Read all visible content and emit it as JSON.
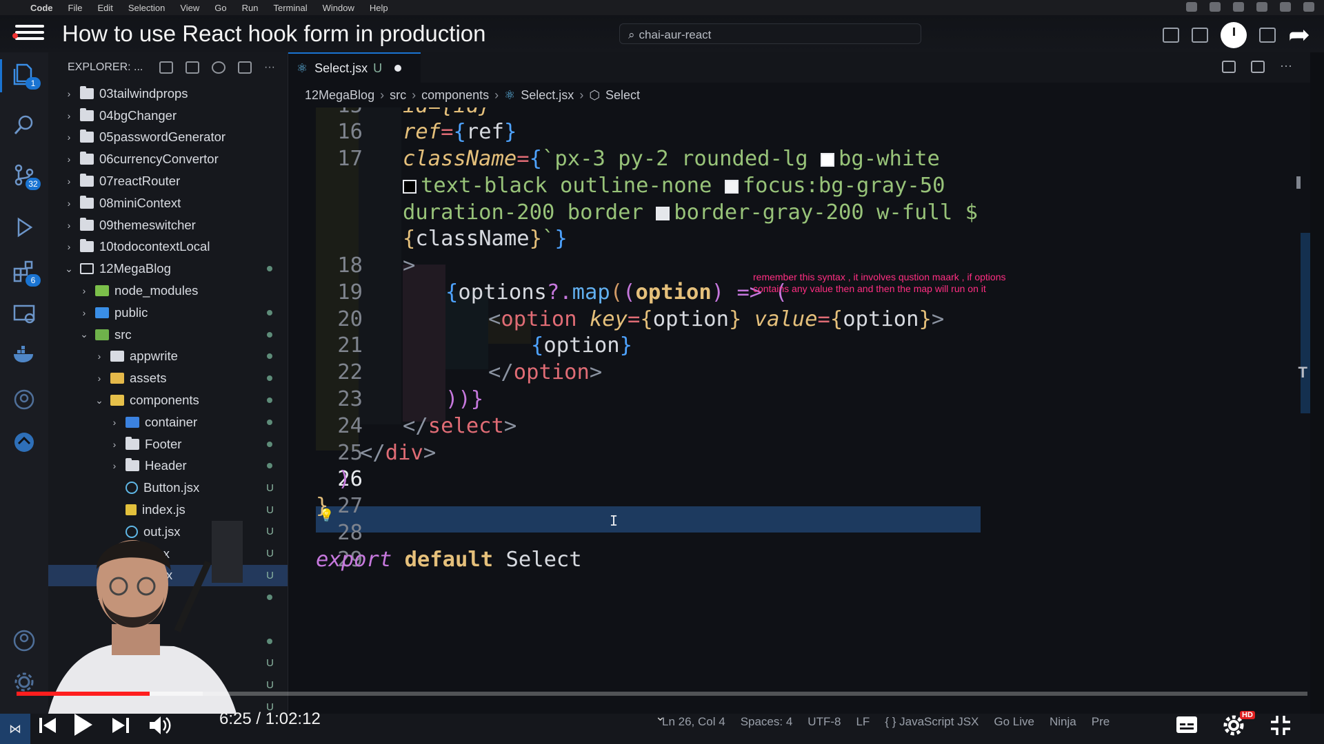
{
  "menubar": {
    "app": "Code",
    "items": [
      "File",
      "Edit",
      "Selection",
      "View",
      "Go",
      "Run",
      "Terminal",
      "Window",
      "Help"
    ]
  },
  "video": {
    "title": "How to use React hook form in production",
    "current_time": "6:25",
    "duration": "1:02:12",
    "time_display": "6:25 / 1:02:12",
    "progress": 0.103,
    "hd_badge": "HD"
  },
  "command_center": {
    "text": "chai-aur-react"
  },
  "activity_bar": {
    "badges": {
      "explorer": "1",
      "source_control": "32",
      "extensions": "6"
    }
  },
  "explorer": {
    "header": "EXPLORER: ...",
    "tree": [
      {
        "label": "03tailwindprops",
        "depth": 0,
        "type": "folder",
        "status": ""
      },
      {
        "label": "04bgChanger",
        "depth": 0,
        "type": "folder",
        "status": ""
      },
      {
        "label": "05passwordGenerator",
        "depth": 0,
        "type": "folder",
        "status": ""
      },
      {
        "label": "06currencyConvertor",
        "depth": 0,
        "type": "folder",
        "status": ""
      },
      {
        "label": "07reactRouter",
        "depth": 0,
        "type": "folder",
        "status": ""
      },
      {
        "label": "08miniContext",
        "depth": 0,
        "type": "folder",
        "status": ""
      },
      {
        "label": "09themeswitcher",
        "depth": 0,
        "type": "folder",
        "status": ""
      },
      {
        "label": "10todocontextLocal",
        "depth": 0,
        "type": "folder",
        "status": ""
      },
      {
        "label": "12MegaBlog",
        "depth": 0,
        "type": "folder-open",
        "status": "dot"
      },
      {
        "label": "node_modules",
        "depth": 1,
        "type": "node",
        "status": ""
      },
      {
        "label": "public",
        "depth": 1,
        "type": "public",
        "status": "dot"
      },
      {
        "label": "src",
        "depth": 1,
        "type": "src",
        "status": "dot"
      },
      {
        "label": "appwrite",
        "depth": 2,
        "type": "appwrite",
        "status": "dot"
      },
      {
        "label": "assets",
        "depth": 2,
        "type": "assets",
        "status": "dot"
      },
      {
        "label": "components",
        "depth": 2,
        "type": "components",
        "status": "dot"
      },
      {
        "label": "container",
        "depth": 3,
        "type": "container",
        "status": "dot"
      },
      {
        "label": "Footer",
        "depth": 3,
        "type": "folder",
        "status": "dot"
      },
      {
        "label": "Header",
        "depth": 3,
        "type": "folder",
        "status": "dot"
      },
      {
        "label": "Button.jsx",
        "depth": 3,
        "type": "react",
        "status": "U"
      },
      {
        "label": "index.js",
        "depth": 3,
        "type": "js",
        "status": "U"
      },
      {
        "label": "out.jsx",
        "depth": 3,
        "type": "react",
        "status": "U"
      },
      {
        "label": "o.jsx",
        "depth": 3,
        "type": "react",
        "status": "U"
      },
      {
        "label": "ct.jsx",
        "depth": 3,
        "type": "react",
        "status": "U"
      },
      {
        "label": "",
        "depth": 2,
        "type": "folder",
        "status": "dot"
      },
      {
        "label": "",
        "depth": 2,
        "type": "none",
        "status": ""
      },
      {
        "label": "",
        "depth": 2,
        "type": "none",
        "status": "dot"
      },
      {
        "label": "",
        "depth": 2,
        "type": "none",
        "status": "U"
      },
      {
        "label": "",
        "depth": 2,
        "type": "none",
        "status": "U"
      },
      {
        "label": "",
        "depth": 2,
        "type": "none",
        "status": "U"
      }
    ]
  },
  "editor": {
    "tab": {
      "label": "Select.jsx",
      "status": "U"
    },
    "breadcrumb": [
      "12MegaBlog",
      "src",
      "components",
      "Select.jsx",
      "Select"
    ],
    "line_numbers": [
      "15",
      "16",
      "17",
      "",
      "",
      "",
      "18",
      "19",
      "20",
      "21",
      "22",
      "23",
      "24",
      "25",
      "26",
      "27",
      "28",
      "29"
    ],
    "current_line": "26",
    "code": {
      "l15": "id={id}",
      "l16_attr": "ref",
      "l16_val": "ref",
      "l17_attr": "className",
      "l17_a": "`px-3 py-2 rounded-lg ",
      "l17_b": "bg-white",
      "l17_c": "text-black outline-none ",
      "l17_d": "focus:bg-gray-50",
      "l17_e": "duration-200 border ",
      "l17_f": "border-gray-200 w-full $",
      "l17_g": "className",
      "l18": ">",
      "l19_a": "options",
      "l19_b": "?.",
      "l19_c": "map",
      "l19_d": "option",
      "l19_e": "=>",
      "l20_tag": "option",
      "l20_key": "key",
      "l20_kv": "option",
      "l20_val": "value",
      "l20_vv": "option",
      "l21": "option",
      "l22": "option",
      "l23": "))}",
      "l24": "select",
      "l25": "div",
      "l26": ")",
      "l27": "}",
      "l29_a": "export",
      "l29_b": "default",
      "l29_c": "Select"
    },
    "annotation": "remember this syntax , it involves qustion maark , if options contains any value then and then the map will run on it"
  },
  "statusbar": {
    "position": "Ln 26, Col 4",
    "spaces": "Spaces: 4",
    "encoding": "UTF-8",
    "eol": "LF",
    "language": "{ } JavaScript JSX",
    "golive": "Go Live",
    "ninja": "Ninja",
    "pre": "Pre"
  },
  "colors": {
    "accent": "#1a74d2",
    "progress": "#ff1e1e",
    "annotation": "#ff2e82",
    "current_line": "#1d3a5f"
  }
}
